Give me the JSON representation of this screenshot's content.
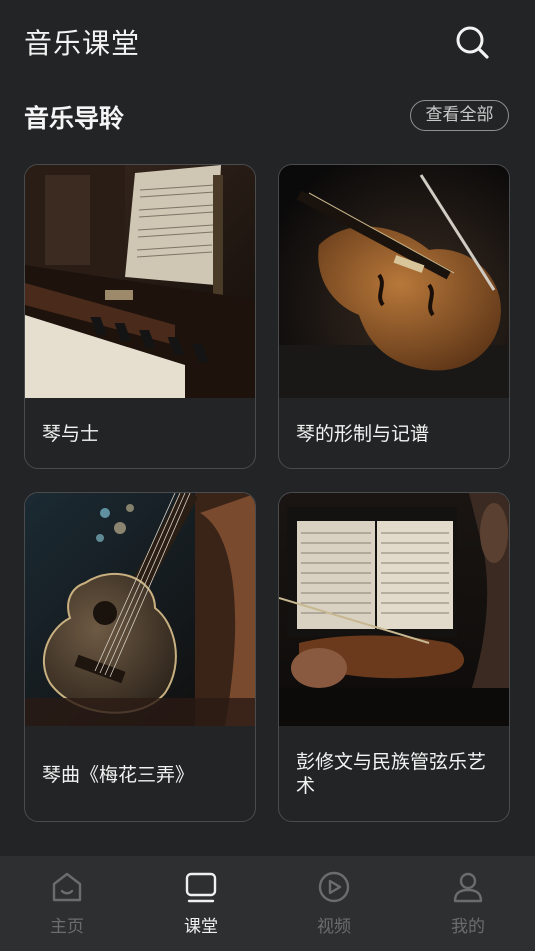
{
  "header": {
    "title": "音乐课堂",
    "search_icon": "search-icon"
  },
  "section": {
    "title": "音乐导聆",
    "view_all": "查看全部"
  },
  "cards": [
    {
      "title": "琴与士",
      "image": "piano-sheet-music-photo"
    },
    {
      "title": "琴的形制与记谱",
      "image": "violin-bow-photo"
    },
    {
      "title": "琴曲《梅花三弄》",
      "image": "ukulele-photo"
    },
    {
      "title": "彭修文与民族管弦乐艺术",
      "image": "orchestra-violin-score-photo"
    }
  ],
  "tabbar": {
    "items": [
      {
        "label": "主页",
        "icon": "home-icon",
        "active": false
      },
      {
        "label": "课堂",
        "icon": "tv-icon",
        "active": true
      },
      {
        "label": "视频",
        "icon": "play-circle-icon",
        "active": false
      },
      {
        "label": "我的",
        "icon": "user-icon",
        "active": false
      }
    ]
  },
  "colors": {
    "background": "#232425",
    "tabbar": "#2e2f31",
    "active": "#f0f0f0",
    "inactive": "#6b6c6e"
  }
}
